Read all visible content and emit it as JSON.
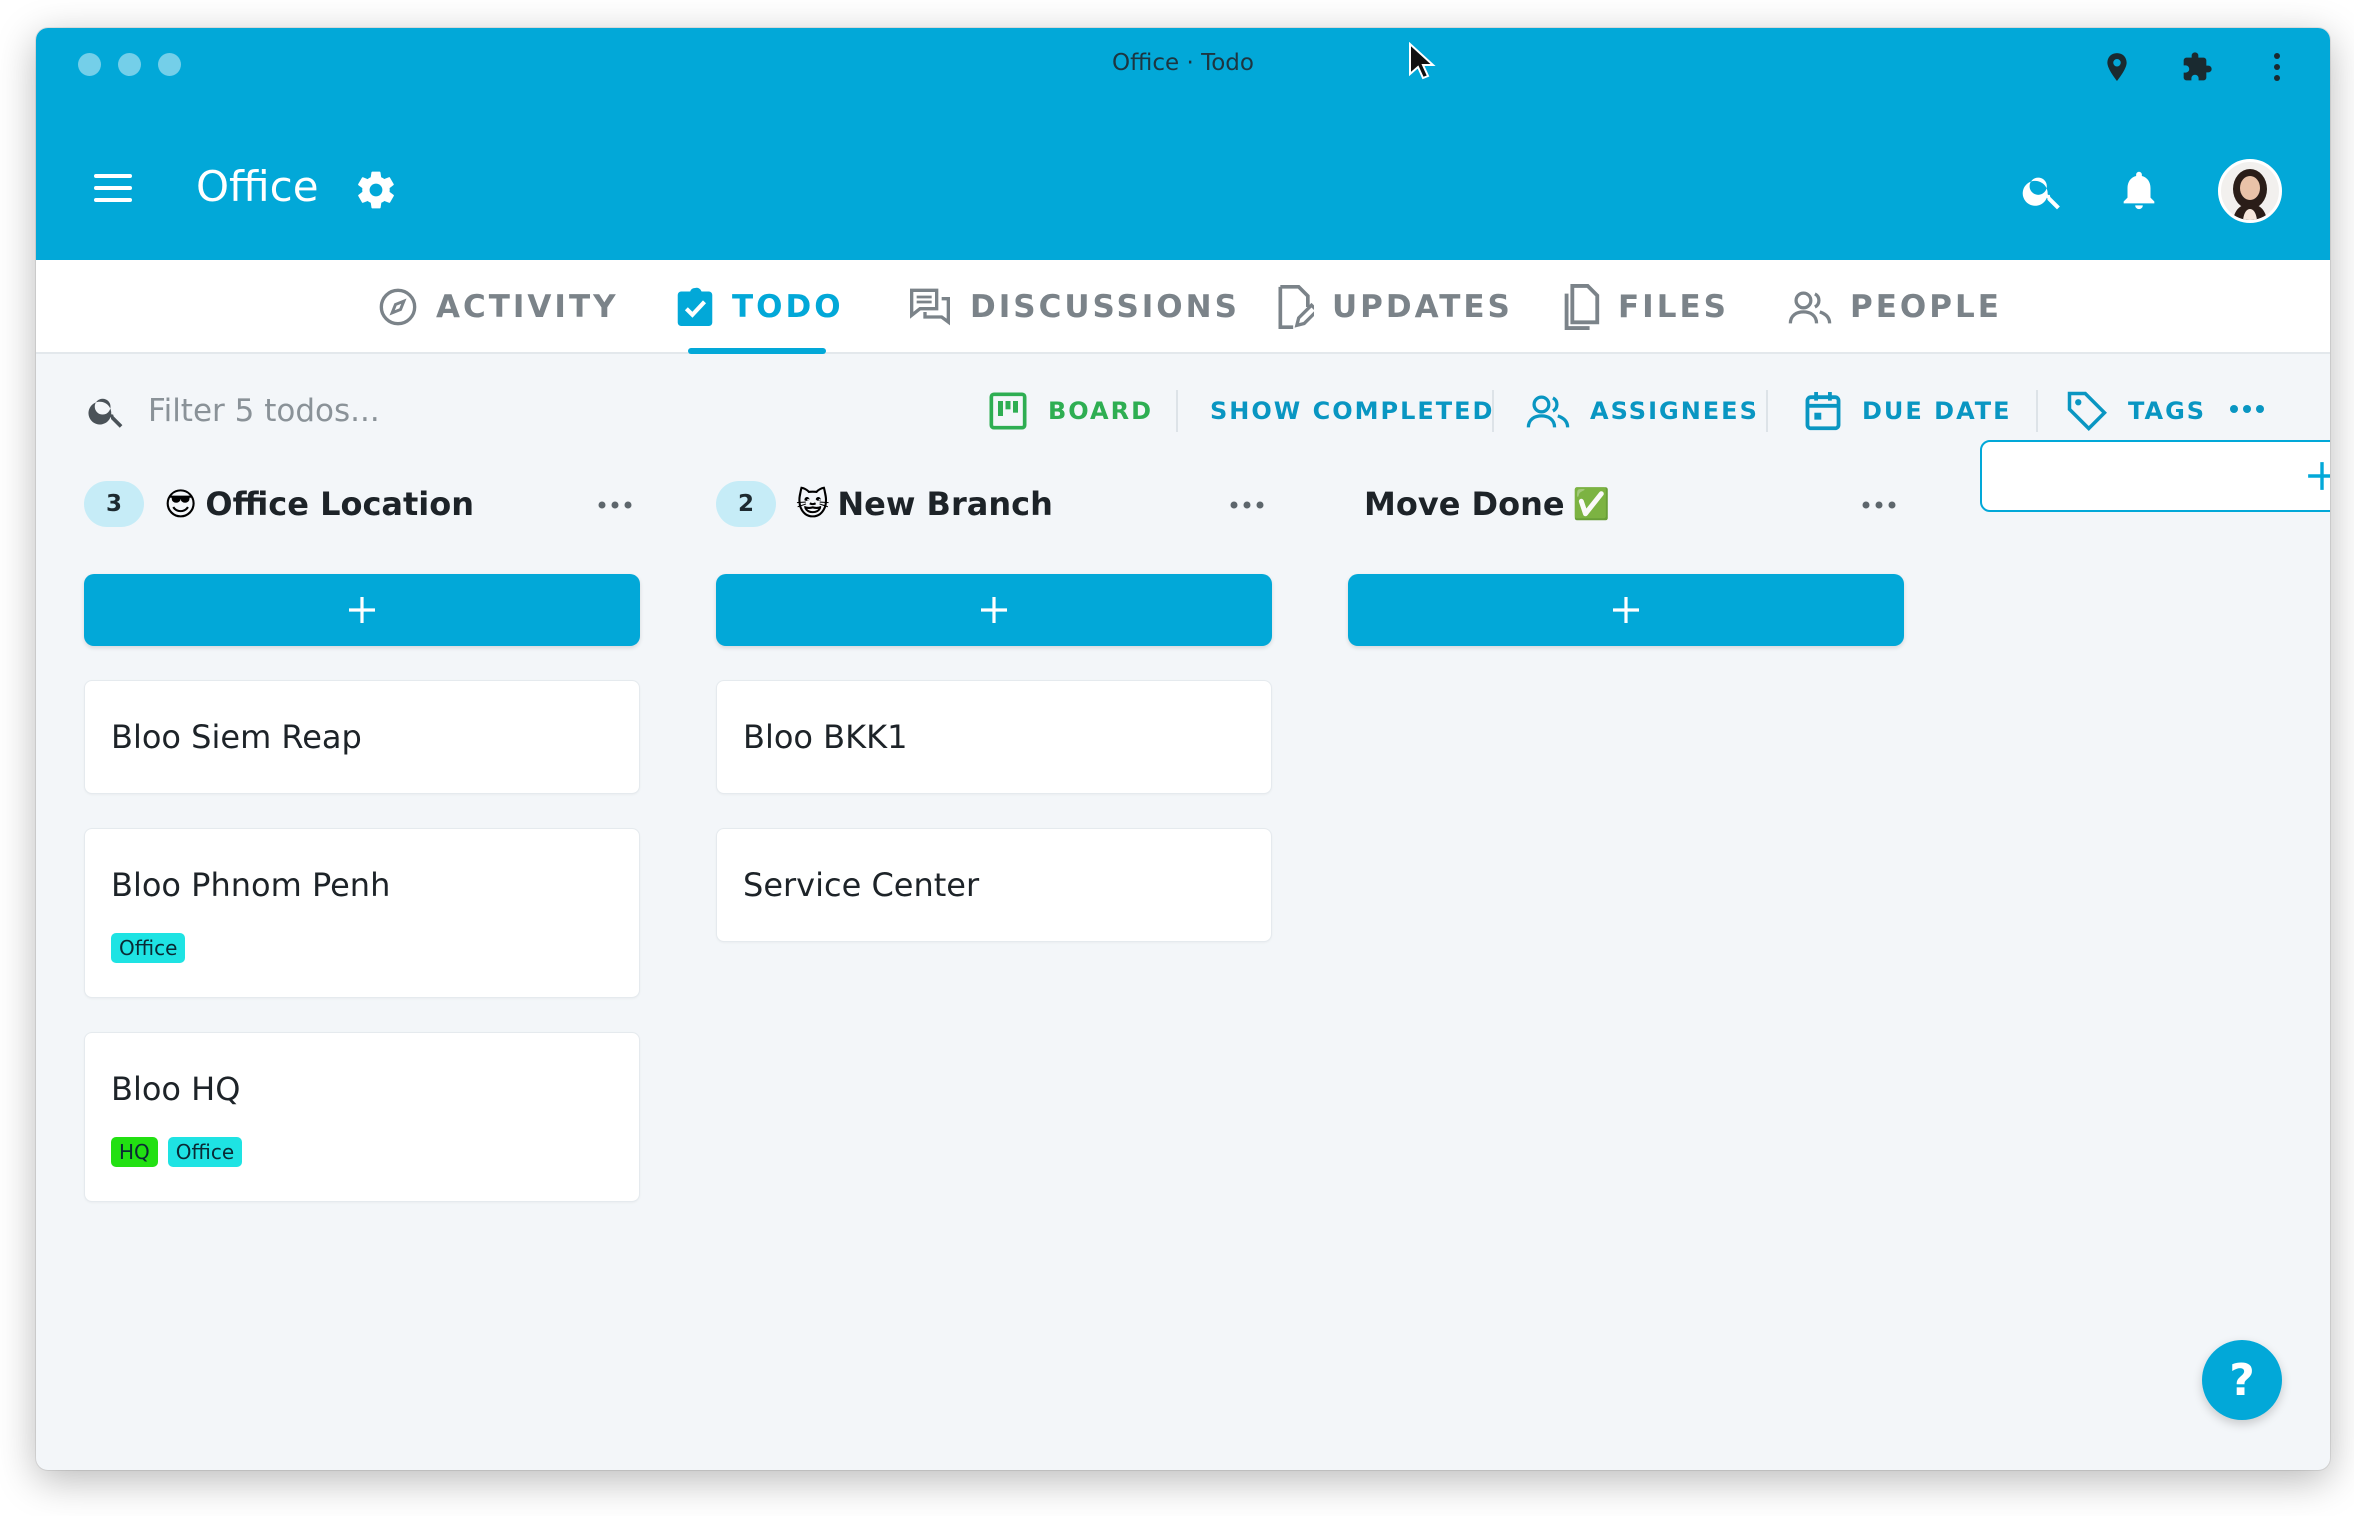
{
  "window": {
    "title": "Office · Todo"
  },
  "appbar": {
    "title": "Office"
  },
  "tabs": [
    {
      "label": "ACTIVITY",
      "icon": "compass-icon",
      "active": false
    },
    {
      "label": "TODO",
      "icon": "checklist-icon",
      "active": true
    },
    {
      "label": "DISCUSSIONS",
      "icon": "chat-icon",
      "active": false
    },
    {
      "label": "UPDATES",
      "icon": "document-edit-icon",
      "active": false
    },
    {
      "label": "FILES",
      "icon": "files-icon",
      "active": false
    },
    {
      "label": "PEOPLE",
      "icon": "people-icon",
      "active": false
    }
  ],
  "filter": {
    "placeholder": "Filter 5 todos...",
    "board_label": "BOARD",
    "show_completed_label": "SHOW COMPLETED",
    "assignees_label": "ASSIGNEES",
    "due_date_label": "DUE DATE",
    "tags_label": "TAGS"
  },
  "columns": [
    {
      "count": "3",
      "emoji": "😎",
      "title": "Office Location",
      "cards": [
        {
          "title": "Bloo Siem Reap",
          "tags": []
        },
        {
          "title": "Bloo Phnom Penh",
          "tags": [
            "Office"
          ]
        },
        {
          "title": "Bloo HQ",
          "tags": [
            "HQ",
            "Office"
          ]
        }
      ]
    },
    {
      "count": "2",
      "emoji": "😺",
      "title": "New Branch",
      "cards": [
        {
          "title": "Bloo BKK1",
          "tags": []
        },
        {
          "title": "Service Center",
          "tags": []
        }
      ]
    },
    {
      "count": "",
      "emoji": "",
      "title": "Move Done",
      "title_emoji": "✅",
      "cards": []
    }
  ],
  "tag_colors": {
    "Office": "#1ee3e3",
    "HQ": "#22e012"
  },
  "colors": {
    "accent": "#02a8d8",
    "board": "#2eae52",
    "link": "#0996c2"
  },
  "help": {
    "label": "?"
  }
}
